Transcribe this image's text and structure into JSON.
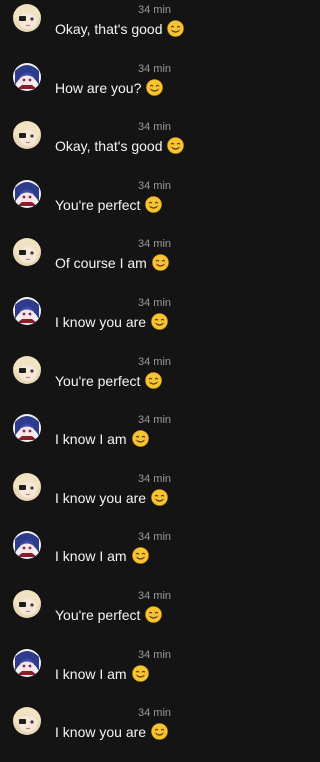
{
  "messages": [
    {
      "sender": "blonde",
      "time": "34 min",
      "text": "Okay, that's good",
      "emoji": "smiling-face-icon"
    },
    {
      "sender": "purple",
      "time": "34 min",
      "text": "How are you?",
      "emoji": "smiling-face-icon"
    },
    {
      "sender": "blonde",
      "time": "34 min",
      "text": "Okay, that's good",
      "emoji": "smiling-face-icon"
    },
    {
      "sender": "purple",
      "time": "34 min",
      "text": "You're perfect",
      "emoji": "smiling-face-icon"
    },
    {
      "sender": "blonde",
      "time": "34 min",
      "text": "Of course I am",
      "emoji": "smiling-face-icon"
    },
    {
      "sender": "purple",
      "time": "34 min",
      "text": "I know you are",
      "emoji": "smiling-face-icon"
    },
    {
      "sender": "blonde",
      "time": "34 min",
      "text": "You're perfect",
      "emoji": "smiling-face-icon"
    },
    {
      "sender": "purple",
      "time": "34 min",
      "text": "I know I am",
      "emoji": "smiling-face-icon"
    },
    {
      "sender": "blonde",
      "time": "34 min",
      "text": "I know you are",
      "emoji": "smiling-face-icon"
    },
    {
      "sender": "purple",
      "time": "34 min",
      "text": "I know I am",
      "emoji": "smiling-face-icon"
    },
    {
      "sender": "blonde",
      "time": "34 min",
      "text": "You're perfect",
      "emoji": "smiling-face-icon"
    },
    {
      "sender": "purple",
      "time": "34 min",
      "text": "I know I am",
      "emoji": "smiling-face-icon"
    },
    {
      "sender": "blonde",
      "time": "34 min",
      "text": "I know you are",
      "emoji": "smiling-face-icon"
    }
  ],
  "colors": {
    "background": "#141414",
    "text": "#f4f4f4",
    "timestamp": "#9a9a9a",
    "emoji": "#f7c531"
  }
}
